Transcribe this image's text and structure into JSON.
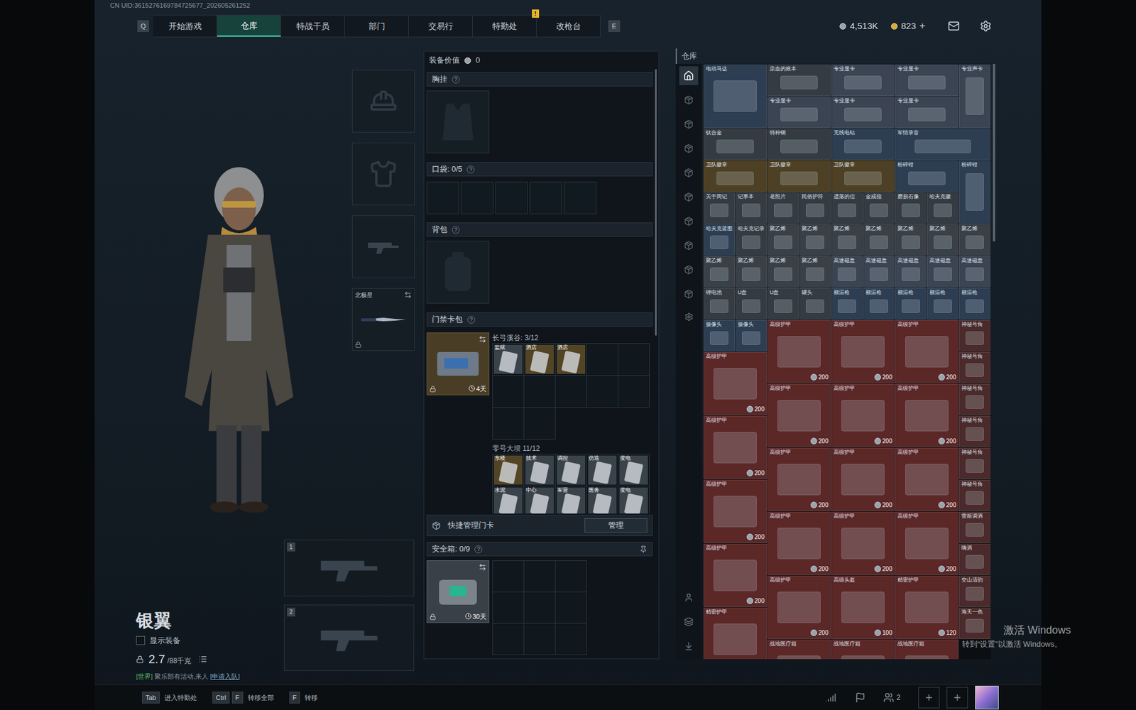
{
  "uid": "CN UID:3615276169784725677_202605261252",
  "nav": {
    "left_key": "Q",
    "right_key": "E",
    "tabs": [
      {
        "label": "开始游戏",
        "selected": false
      },
      {
        "label": "仓库",
        "selected": true
      },
      {
        "label": "特战干员",
        "selected": false
      },
      {
        "label": "部门",
        "selected": false
      },
      {
        "label": "交易行",
        "selected": false
      },
      {
        "label": "特勤处",
        "selected": false
      },
      {
        "label": "改枪台",
        "selected": false,
        "badge": "!"
      }
    ],
    "currency": [
      {
        "kind": "silver",
        "amount": "4,513K"
      },
      {
        "kind": "gold",
        "amount": "823",
        "add": "+"
      }
    ]
  },
  "character": {
    "name": "银翼",
    "show_equipment": {
      "label": "显示装备",
      "checked": false
    },
    "weight": "2.7",
    "weight_max": "/88千克"
  },
  "slots": [
    {
      "kind": "helmet",
      "filled": false
    },
    {
      "kind": "armor",
      "filled": false
    },
    {
      "kind": "pistol",
      "filled": false
    },
    {
      "kind": "melee",
      "filled": true,
      "name": "北极星",
      "locked": true
    }
  ],
  "weapon_slots": [
    {
      "number": "1",
      "filled": false
    },
    {
      "number": "2",
      "filled": false
    }
  ],
  "chat": {
    "channel": "[世界]",
    "message": "聚乐部有活动,来人",
    "link": "[申请入队]"
  },
  "loadout": {
    "value_label": "装备价值",
    "value": "0",
    "chest_rig": {
      "label": "胸挂",
      "help": "?"
    },
    "pockets": {
      "label": "口袋: 0/5",
      "help": "?",
      "slots": [
        {
          "filled": false
        },
        {
          "filled": false
        },
        {
          "filled": false
        },
        {
          "filled": false
        },
        {
          "filled": false
        }
      ]
    },
    "backpack": {
      "label": "背包",
      "help": "?"
    },
    "keycard_case": {
      "label": "门禁卡包",
      "help": "?",
      "days": "4天",
      "locked": true,
      "maps": [
        {
          "name": "长弓溪谷: 3/12",
          "slots": 12,
          "cards": [
            {
              "label": "监狱",
              "color": "#5d6670"
            },
            {
              "label": "酒店",
              "color": "#8a6a2e"
            },
            {
              "label": "酒店",
              "color": "#8a6a2e"
            }
          ]
        },
        {
          "name": "零号大坝 11/12",
          "slots": 10,
          "cards": [
            {
              "label": "东楼",
              "color": "#8a6a2e"
            },
            {
              "label": "技术",
              "color": "#5d6670"
            },
            {
              "label": "调控",
              "color": "#5d6670"
            },
            {
              "label": "仿造",
              "color": "#5d6670"
            },
            {
              "label": "变电",
              "color": "#5d6670"
            },
            {
              "label": "水泥",
              "color": "#5d6670"
            },
            {
              "label": "中心",
              "color": "#5d6670"
            },
            {
              "label": "军营",
              "color": "#5d6670"
            },
            {
              "label": "医务",
              "color": "#5d6670"
            },
            {
              "label": "变电",
              "color": "#5d6670"
            }
          ]
        }
      ]
    },
    "quick_manage": {
      "label": "快捷管理门卡",
      "button": "管理"
    },
    "safe_box": {
      "label": "安全箱: 0/9",
      "help": "?",
      "days": "30天",
      "locked": true,
      "slots": 9
    }
  },
  "stash": {
    "title": "仓库",
    "categories": [
      {
        "selected": true
      },
      {
        "selected": false
      },
      {
        "selected": false
      },
      {
        "selected": false
      },
      {
        "selected": false
      },
      {
        "selected": false
      },
      {
        "selected": false
      },
      {
        "selected": false
      },
      {
        "selected": false
      },
      {
        "selected": false
      }
    ],
    "items": [
      {
        "name": "电动马达",
        "kind": "big",
        "color": "#2d3d52"
      },
      {
        "name": "染血的账本",
        "kind": "wide",
        "color": "#343b43"
      },
      {
        "name": "专业显卡",
        "kind": "wide",
        "color": "#3a4452"
      },
      {
        "name": "专业显卡",
        "kind": "wide",
        "color": "#3a4452"
      },
      {
        "name": "专业声卡",
        "kind": "tall",
        "color": "#3a4452"
      },
      {
        "name": "专业显卡",
        "kind": "wide",
        "color": "#3a4452"
      },
      {
        "name": "专业显卡",
        "kind": "wide",
        "color": "#3a4452"
      },
      {
        "name": "专业显卡",
        "kind": "wide",
        "color": "#3a4452"
      },
      {
        "name": "钛合金",
        "kind": "wide",
        "color": "#343b43"
      },
      {
        "name": "特种钢",
        "kind": "wide",
        "color": "#343b43"
      },
      {
        "name": "无线电钻",
        "kind": "wide",
        "color": "#2d3d52"
      },
      {
        "name": "军情录音",
        "kind": "wide3",
        "color": "#2d3d52"
      },
      {
        "name": "卫队徽章",
        "kind": "wide",
        "color": "#4d4024"
      },
      {
        "name": "卫队徽章",
        "kind": "wide",
        "color": "#4d4024"
      },
      {
        "name": "卫队徽章",
        "kind": "wide",
        "color": "#4d4024"
      },
      {
        "name": "粉碎钳",
        "kind": "wide",
        "color": "#2d3d52"
      },
      {
        "name": "粉碎钳",
        "kind": "tall",
        "color": "#2d3d52"
      },
      {
        "name": "关于周记",
        "kind": "small",
        "color": "#343b43"
      },
      {
        "name": "记事本",
        "kind": "small",
        "color": "#343b43"
      },
      {
        "name": "老照片",
        "kind": "small",
        "color": "#343b43"
      },
      {
        "name": "民俗护符",
        "kind": "small",
        "color": "#343b43"
      },
      {
        "name": "遗落的信",
        "kind": "small",
        "color": "#343b43"
      },
      {
        "name": "金戒指",
        "kind": "small",
        "color": "#343b43"
      },
      {
        "name": "磨损石像",
        "kind": "small",
        "color": "#343b43"
      },
      {
        "name": "哈夫克徽",
        "kind": "small",
        "color": "#343b43"
      },
      {
        "name": "哈夫克蓝图",
        "kind": "small",
        "color": "#2d3d52"
      },
      {
        "name": "哈夫克记录",
        "kind": "small",
        "color": "#343b43"
      },
      {
        "name": "聚乙烯",
        "kind": "small",
        "color": "#3a4048"
      },
      {
        "name": "聚乙烯",
        "kind": "small",
        "color": "#3a4048"
      },
      {
        "name": "聚乙烯",
        "kind": "small",
        "color": "#3a4048"
      },
      {
        "name": "聚乙烯",
        "kind": "small",
        "color": "#3a4048"
      },
      {
        "name": "聚乙烯",
        "kind": "small",
        "color": "#3a4048"
      },
      {
        "name": "聚乙烯",
        "kind": "small",
        "color": "#3a4048"
      },
      {
        "name": "聚乙烯",
        "kind": "small",
        "color": "#3a4048"
      },
      {
        "name": "聚乙烯",
        "kind": "small",
        "color": "#3a4048"
      },
      {
        "name": "聚乙烯",
        "kind": "small",
        "color": "#3a4048"
      },
      {
        "name": "聚乙烯",
        "kind": "small",
        "color": "#3a4048"
      },
      {
        "name": "聚乙烯",
        "kind": "small",
        "color": "#3a4048"
      },
      {
        "name": "高速磁盘",
        "kind": "small",
        "color": "#3a4452"
      },
      {
        "name": "高速磁盘",
        "kind": "small",
        "color": "#3a4452"
      },
      {
        "name": "高速磁盘",
        "kind": "small",
        "color": "#3a4452"
      },
      {
        "name": "高速磁盘",
        "kind": "small",
        "color": "#3a4452"
      },
      {
        "name": "高速磁盘",
        "kind": "small",
        "color": "#3a4452"
      },
      {
        "name": "锂电池",
        "kind": "small",
        "color": "#343b43"
      },
      {
        "name": "U盘",
        "kind": "small",
        "color": "#343b43"
      },
      {
        "name": "U盘",
        "kind": "small",
        "color": "#343b43"
      },
      {
        "name": "罐头",
        "kind": "small",
        "color": "#343b43"
      },
      {
        "name": "额温枪",
        "kind": "small",
        "color": "#2d3d52"
      },
      {
        "name": "额温枪",
        "kind": "small",
        "color": "#2d3d52"
      },
      {
        "name": "额温枪",
        "kind": "small",
        "color": "#2d3d52"
      },
      {
        "name": "额温枪",
        "kind": "small",
        "color": "#2d3d52"
      },
      {
        "name": "额温枪",
        "kind": "small",
        "color": "#2d3d52"
      },
      {
        "name": "摄像头",
        "kind": "small",
        "color": "#2d3d52"
      },
      {
        "name": "摄像头",
        "kind": "small",
        "color": "#2d3d52"
      },
      {
        "name": "高级护甲",
        "kind": "big",
        "color": "#5b2727",
        "price": "200"
      },
      {
        "name": "高级护甲",
        "kind": "big",
        "color": "#5b2727",
        "price": "200"
      },
      {
        "name": "高级护甲",
        "kind": "big",
        "color": "#5b2727",
        "price": "200"
      },
      {
        "name": "神秘号角",
        "kind": "small",
        "color": "#4a2a2a"
      },
      {
        "name": "高级护甲",
        "kind": "big",
        "color": "#5b2727",
        "price": "200"
      },
      {
        "name": "神秘号角",
        "kind": "small",
        "color": "#4a2a2a"
      },
      {
        "name": "高级护甲",
        "kind": "big",
        "color": "#5b2727",
        "price": "200"
      },
      {
        "name": "高级护甲",
        "kind": "big",
        "color": "#5b2727",
        "price": "200"
      },
      {
        "name": "高级护甲",
        "kind": "big",
        "color": "#5b2727",
        "price": "200"
      },
      {
        "name": "神秘号角",
        "kind": "small",
        "color": "#4a2a2a"
      },
      {
        "name": "高级护甲",
        "kind": "big",
        "color": "#5b2727",
        "price": "200"
      },
      {
        "name": "神秘号角",
        "kind": "small",
        "color": "#4a2a2a"
      },
      {
        "name": "高级护甲",
        "kind": "big",
        "color": "#5b2727",
        "price": "200"
      },
      {
        "name": "高级护甲",
        "kind": "big",
        "color": "#5b2727",
        "price": "200"
      },
      {
        "name": "高级护甲",
        "kind": "big",
        "color": "#5b2727",
        "price": "200"
      },
      {
        "name": "神秘号角",
        "kind": "small",
        "color": "#4a2a2a"
      },
      {
        "name": "高级护甲",
        "kind": "big",
        "color": "#5b2727",
        "price": "200"
      },
      {
        "name": "神秘号角",
        "kind": "small",
        "color": "#4a2a2a"
      },
      {
        "name": "高级护甲",
        "kind": "big",
        "color": "#5b2727",
        "price": "200"
      },
      {
        "name": "高级护甲",
        "kind": "big",
        "color": "#5b2727",
        "price": "200"
      },
      {
        "name": "高级护甲",
        "kind": "big",
        "color": "#5b2727",
        "price": "200"
      },
      {
        "name": "雷斯调酒",
        "kind": "small",
        "color": "#4a2a2a"
      },
      {
        "name": "高级护甲",
        "kind": "big",
        "color": "#5b2727",
        "price": "200"
      },
      {
        "name": "嗨酒",
        "kind": "small",
        "color": "#4a2a2a"
      },
      {
        "name": "高级护甲",
        "kind": "big",
        "color": "#5b2727",
        "price": "200"
      },
      {
        "name": "高级头盔",
        "kind": "big",
        "color": "#5b2727",
        "price": "100"
      },
      {
        "name": "精密护甲",
        "kind": "big",
        "color": "#5b2727",
        "price": "120"
      },
      {
        "name": "空山清韵",
        "kind": "small",
        "color": "#4a2a2a"
      },
      {
        "name": "精密护甲",
        "kind": "big",
        "color": "#5b2727"
      },
      {
        "name": "海天一色",
        "kind": "small",
        "color": "#4a2a2a"
      },
      {
        "name": "战地医疗箱",
        "kind": "big",
        "color": "#5b2727"
      },
      {
        "name": "战地医疗箱",
        "kind": "big",
        "color": "#5b2727"
      },
      {
        "name": "战地医疗箱",
        "kind": "big",
        "color": "#5b2727"
      }
    ]
  },
  "bottom_bar": {
    "hints": [
      {
        "keys": [
          "Tab"
        ],
        "label": "进入特勤处"
      },
      {
        "keys": [
          "Ctrl",
          "F"
        ],
        "label": "转移全部"
      },
      {
        "keys": [
          "F"
        ],
        "label": "转移"
      }
    ],
    "party_count": "2"
  },
  "watermark": {
    "title": "激活 Windows",
    "subtitle": "转到“设置”以激活 Windows。"
  }
}
